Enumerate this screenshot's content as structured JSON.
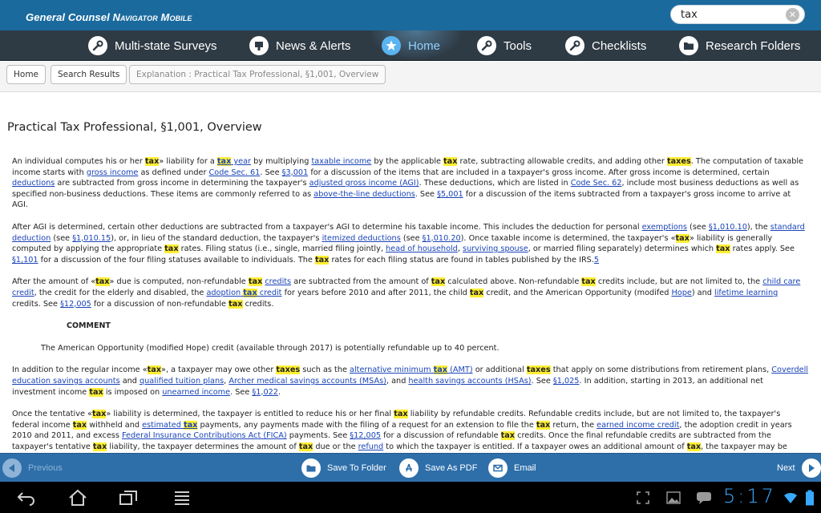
{
  "header": {
    "brand_prefix": "General Counsel",
    "brand_suffix": "Navigator Mobile",
    "search": {
      "value": "tax",
      "placeholder": ""
    }
  },
  "nav": {
    "items": [
      {
        "label": "Multi-state Surveys",
        "icon": "wrench-icon"
      },
      {
        "label": "News & Alerts",
        "icon": "megaphone-icon"
      },
      {
        "label": "Home",
        "icon": "star-icon",
        "active": true
      },
      {
        "label": "Tools",
        "icon": "wrench-icon"
      },
      {
        "label": "Checklists",
        "icon": "wrench-icon"
      },
      {
        "label": "Research Folders",
        "icon": "folder-icon"
      }
    ]
  },
  "breadcrumb": {
    "home": "Home",
    "search_results": "Search Results",
    "current": "Explanation : Practical Tax Professional, §1,001, Overview"
  },
  "document": {
    "title": "Practical Tax Professional, §1,001, Overview",
    "comment_heading": "COMMENT",
    "comment_text": "The American Opportunity (modified Hope) credit (available through 2017) is potentially refundable up to 40 percent."
  },
  "actions": {
    "previous": "Previous",
    "save_folder": "Save To Folder",
    "save_pdf": "Save As PDF",
    "email": "Email",
    "next": "Next"
  },
  "system": {
    "clock": "5:17"
  },
  "colors": {
    "header": "#1a6a9e",
    "nav": "#2e3a44",
    "actionbar": "#2e6faa",
    "highlight": "#ffee33",
    "link": "#1a44b8"
  }
}
